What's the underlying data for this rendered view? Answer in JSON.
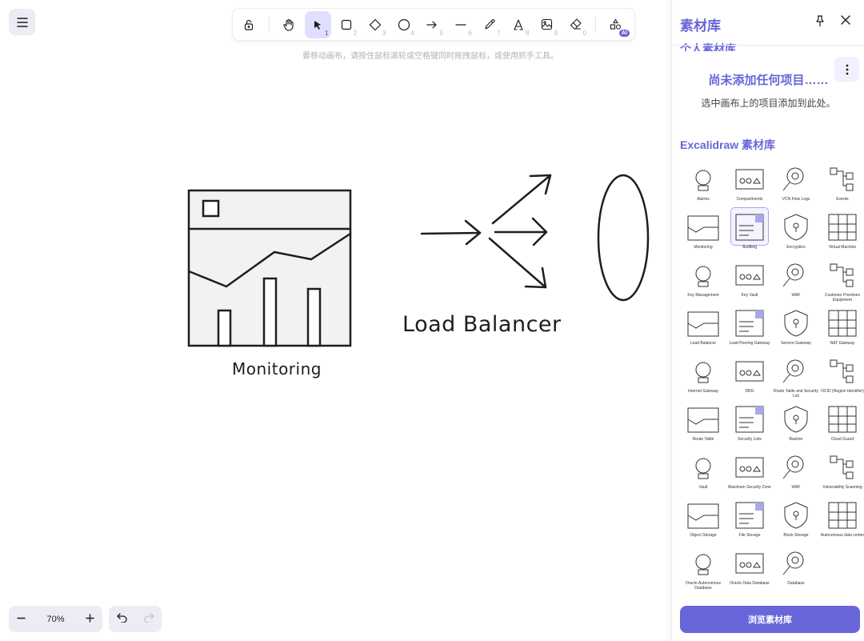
{
  "toolbar": {
    "tools": [
      {
        "name": "lock-icon",
        "key": ""
      },
      {
        "name": "hand-icon",
        "key": ""
      },
      {
        "name": "selection-icon",
        "key": "1"
      },
      {
        "name": "rectangle-icon",
        "key": "2"
      },
      {
        "name": "diamond-icon",
        "key": "3"
      },
      {
        "name": "ellipse-icon",
        "key": "4"
      },
      {
        "name": "arrow-icon",
        "key": "5"
      },
      {
        "name": "line-icon",
        "key": "6"
      },
      {
        "name": "pencil-icon",
        "key": "7"
      },
      {
        "name": "text-icon",
        "key": "8"
      },
      {
        "name": "image-icon",
        "key": "9"
      },
      {
        "name": "eraser-icon",
        "key": "0"
      }
    ],
    "ai_badge": "AI"
  },
  "hint": "要移动画布，请按住鼠标滚轮或空格键同时拖拽鼠标，或使用抓手工具。",
  "canvas": {
    "monitoring_label": "Monitoring",
    "load_balancer_label": "Load Balancer"
  },
  "library": {
    "title": "素材库",
    "personal_title": "个人素材库",
    "empty_title": "尚未添加任何项目……",
    "empty_sub": "选中画布上的项目添加到此处。",
    "excalidraw_title": "Excalidraw 素材库",
    "browse_button": "浏览素材库",
    "items": [
      "Alarms",
      "Compartments",
      "VCN Flow Logs",
      "Events",
      "Monitoring",
      "Auditing",
      "Encryption",
      "Virtual Machine",
      "Key Management",
      "Key Vault",
      "WAF",
      "Customer Premises Equipment",
      "Load Balancer",
      "Load Peering Gateway",
      "Service Gateway",
      "NAT Gateway",
      "Internet Gateway",
      "DRG",
      "Route Table and Security List",
      "OCID (Region Identifier)",
      "Route Table",
      "Security Lists",
      "Bastion",
      "Cloud Guard",
      "Vault",
      "Maximum Security Zone",
      "WAF",
      "Vulnerability Scanning",
      "Object Storage",
      "File Storage",
      "Block Storage",
      "Autonomous data center",
      "Oracle Autonomous Database",
      "Oracle Data Database",
      "Database",
      ""
    ]
  },
  "zoom": {
    "value": "70%"
  }
}
